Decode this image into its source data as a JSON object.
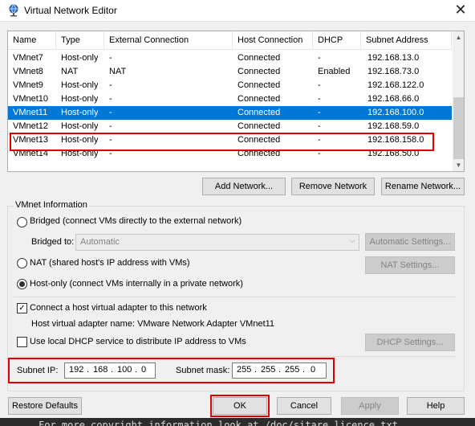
{
  "window": {
    "title": "Virtual Network Editor",
    "close_glyph": "✕",
    "app_icon": "network-globe-icon"
  },
  "table": {
    "columns": [
      "Name",
      "Type",
      "External Connection",
      "Host Connection",
      "DHCP",
      "Subnet Address"
    ],
    "rows": [
      {
        "name": "VMnet7",
        "type": "Host-only",
        "external": "-",
        "host": "Connected",
        "dhcp": "-",
        "subnet": "192.168.13.0"
      },
      {
        "name": "VMnet8",
        "type": "NAT",
        "external": "NAT",
        "host": "Connected",
        "dhcp": "Enabled",
        "subnet": "192.168.73.0"
      },
      {
        "name": "VMnet9",
        "type": "Host-only",
        "external": "-",
        "host": "Connected",
        "dhcp": "-",
        "subnet": "192.168.122.0"
      },
      {
        "name": "VMnet10",
        "type": "Host-only",
        "external": "-",
        "host": "Connected",
        "dhcp": "-",
        "subnet": "192.168.66.0"
      },
      {
        "name": "VMnet11",
        "type": "Host-only",
        "external": "-",
        "host": "Connected",
        "dhcp": "-",
        "subnet": "192.168.100.0"
      },
      {
        "name": "VMnet12",
        "type": "Host-only",
        "external": "-",
        "host": "Connected",
        "dhcp": "-",
        "subnet": "192.168.59.0"
      },
      {
        "name": "VMnet13",
        "type": "Host-only",
        "external": "-",
        "host": "Connected",
        "dhcp": "-",
        "subnet": "192.168.158.0"
      },
      {
        "name": "VMnet14",
        "type": "Host-only",
        "external": "-",
        "host": "Connected",
        "dhcp": "-",
        "subnet": "192.168.50.0"
      }
    ],
    "selected_row": "VMnet11",
    "scroll_up_glyph": "▲",
    "scroll_down_glyph": "▼"
  },
  "list_buttons": {
    "add": "Add Network...",
    "remove": "Remove Network",
    "rename": "Rename Network..."
  },
  "vmnet_info": {
    "group_label": "VMnet Information",
    "bridged_label": "Bridged (connect VMs directly to the external network)",
    "bridged_to_label": "Bridged to:",
    "bridged_to_value": "Automatic",
    "combo_arrow": "⌵",
    "automatic_settings": "Automatic Settings...",
    "nat_label": "NAT (shared host's IP address with VMs)",
    "nat_settings": "NAT Settings...",
    "hostonly_label": "Host-only (connect VMs internally in a private network)",
    "selected_mode": "host-only",
    "connect_adapter_label": "Connect a host virtual adapter to this network",
    "connect_adapter_checked": true,
    "check_glyph": "✓",
    "adapter_name_text": "Host virtual adapter name: VMware Network Adapter VMnet11",
    "dhcp_label": "Use local DHCP service to distribute IP address to VMs",
    "dhcp_checked": false,
    "dhcp_settings": "DHCP Settings...",
    "subnet_ip_label": "Subnet IP:",
    "subnet_ip": [
      "192",
      "168",
      "100",
      "0"
    ],
    "subnet_mask_label": "Subnet mask:",
    "subnet_mask": [
      "255",
      "255",
      "255",
      "0"
    ],
    "ip_dot": "."
  },
  "footer": {
    "restore_defaults": "Restore Defaults",
    "ok": "OK",
    "cancel": "Cancel",
    "apply": "Apply",
    "help": "Help"
  },
  "background_terminal_text": "For more copyright information look at /doc/sitare_licence.txt",
  "colors": {
    "selection": "#0078d7",
    "highlight_outline": "#e00000"
  }
}
